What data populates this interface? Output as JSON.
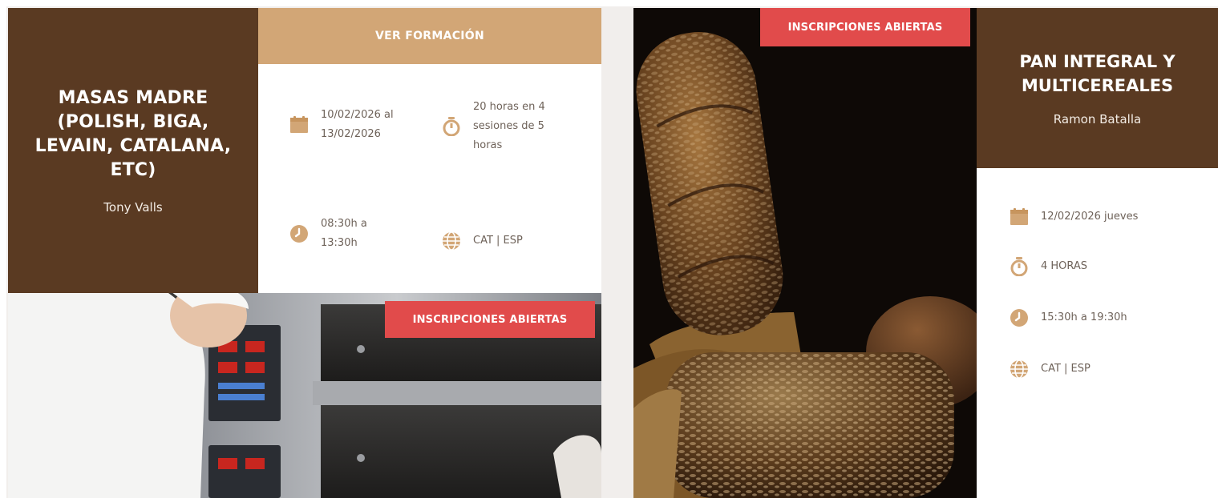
{
  "colors": {
    "brown": "#5a3a22",
    "tan": "#d2a676",
    "badge_red": "#e14b4b",
    "icon_tan": "#d2a676",
    "text_gray": "#6e6259"
  },
  "course1": {
    "title": "MASAS MADRE (POLISH, BIGA, LEVAIN, CATALANA, ETC)",
    "author": "Tony Valls",
    "button_label": "VER FORMACIÓN",
    "badge": "INSCRIPCIONES ABIERTAS",
    "dates": "10/02/2026 al 13/02/2026",
    "duration": "20 horas en 4 sesiones de 5 horas",
    "schedule": "08:30h a 13:30h",
    "language": "CAT | ESP",
    "icons": [
      "calendar-icon",
      "timer-icon",
      "clock-icon",
      "globe-icon"
    ]
  },
  "course2": {
    "title": "PAN INTEGRAL Y MULTICEREALES",
    "author": "Ramon Batalla",
    "badge": "INSCRIPCIONES ABIERTAS",
    "date": "12/02/2026 jueves",
    "duration": "4 HORAS",
    "schedule": "15:30h a 19:30h",
    "language": "CAT | ESP",
    "icons": [
      "calendar-icon",
      "timer-icon",
      "clock-icon",
      "globe-icon"
    ]
  }
}
